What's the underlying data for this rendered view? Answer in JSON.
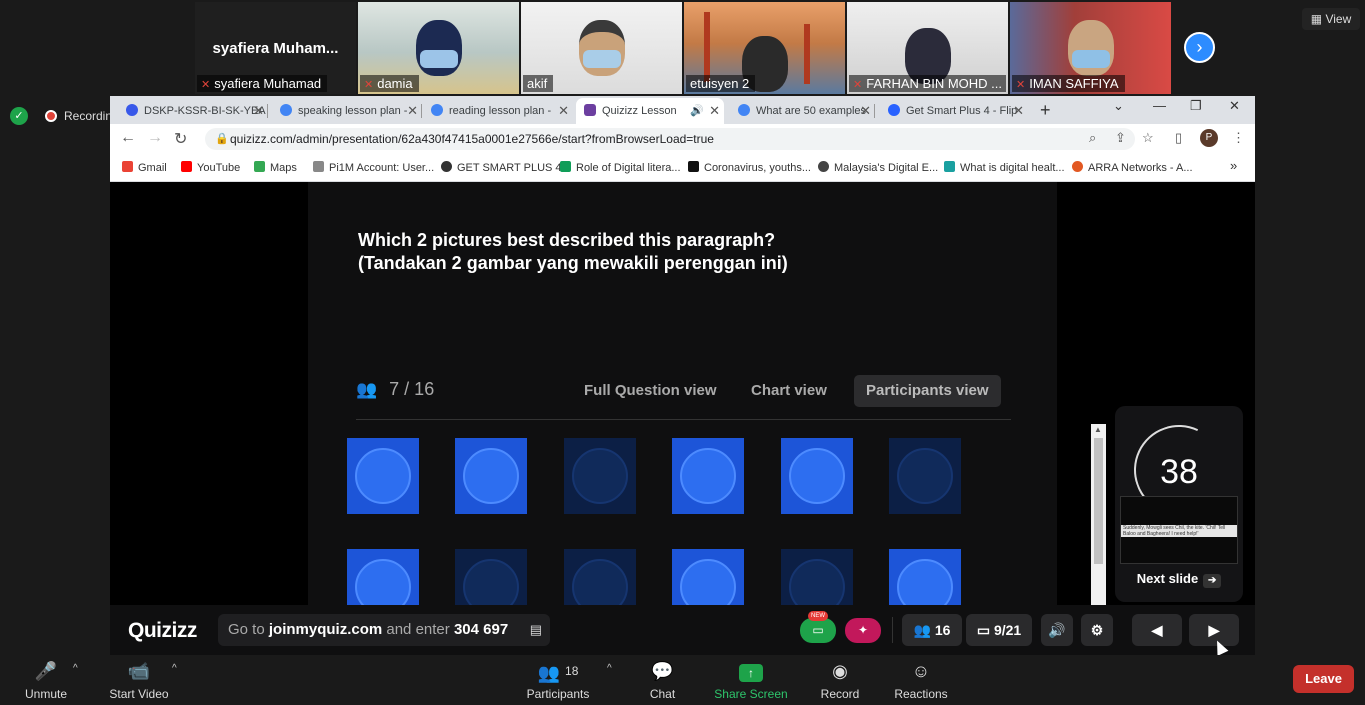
{
  "gallery": {
    "tiles": [
      {
        "name": "syafiera Muhamad",
        "big_name": "syafiera  Muham...",
        "bg": "#1f1f1f"
      },
      {
        "name": "damia",
        "bg": "#b8c7c4",
        "face": "#1c2a52"
      },
      {
        "name": "akif",
        "bg": "#e9e9e9",
        "face": "#3a3a3a"
      },
      {
        "name": "etuisyen 2",
        "bg": "#c37a46",
        "face": "#2a2a2a"
      },
      {
        "name": "FARHAN BIN MOHD ...",
        "bg": "#d9d9d9",
        "face": "#4a4d66"
      },
      {
        "name": "IMAN SAFFIYA",
        "bg": "#a13f3a",
        "face": "#c9a581"
      }
    ],
    "next_icon": "chevron-right-icon",
    "view_label": "View"
  },
  "recording": {
    "label": "Recording"
  },
  "browser": {
    "tabs": [
      {
        "label": "DSKP-KSSR-BI-SK-YEA",
        "color": "#3858e9"
      },
      {
        "label": "speaking lesson plan -",
        "color": "#4285f4"
      },
      {
        "label": "reading lesson plan -",
        "color": "#4285f4"
      },
      {
        "label": "Quizizz Lesson",
        "color": "#6c3fa0"
      },
      {
        "label": "What are 50 examples",
        "color": "#4285f4"
      },
      {
        "label": "Get Smart Plus 4 - Flip",
        "color": "#2962ff"
      }
    ],
    "url": "quizizz.com/admin/presentation/62a430f47415a0001e27566e/start?fromBrowserLoad=true",
    "profile_initial": "P",
    "bookmarks": [
      {
        "label": "Gmail",
        "color": "#ea4335"
      },
      {
        "label": "YouTube",
        "color": "#ff0000"
      },
      {
        "label": "Maps",
        "color": "#34a853"
      },
      {
        "label": "Pi1M Account: User...",
        "color": "#888888"
      },
      {
        "label": "GET SMART PLUS 4",
        "color": "#333333"
      },
      {
        "label": "Role of Digital litera...",
        "color": "#0f9d58"
      },
      {
        "label": "Coronavirus, youths...",
        "color": "#111111"
      },
      {
        "label": "Malaysia's Digital E...",
        "color": "#444444"
      },
      {
        "label": "What is digital healt...",
        "color": "#1aa0a0"
      },
      {
        "label": "ARRA Networks - A...",
        "color": "#e25822"
      }
    ]
  },
  "quiz": {
    "question_line1": "Which 2 pictures best described this paragraph?",
    "question_line2": "(Tandakan 2 gambar yang mewakili perenggan ini)",
    "answered_count": "7 / 16",
    "view_tabs": [
      "Full Question view",
      "Chart view",
      "Participants view"
    ],
    "avatars_row1": [
      true,
      true,
      false,
      true,
      true,
      false
    ],
    "avatars_row2": [
      true,
      false,
      false,
      true,
      false,
      true
    ],
    "timer": "38",
    "next_slide_label": "Next slide",
    "slide_thumb_text": "Suddenly, Mowgli sees Chil, the kite. 'Chil! Tell Baloo and Bagheera! I need help!'"
  },
  "quizbar": {
    "logo": "Quizizz",
    "join_prefix": "Go to",
    "join_site": "joinmyquiz.com",
    "join_middle": "and enter",
    "join_code": "304 697",
    "new_badge": "NEW",
    "participants": "16",
    "slides": "9/21"
  },
  "toolbar": {
    "unmute": "Unmute",
    "start_video": "Start Video",
    "participants": "Participants",
    "participants_count": "18",
    "chat": "Chat",
    "share_screen": "Share Screen",
    "record": "Record",
    "reactions": "Reactions",
    "leave": "Leave"
  },
  "colors": {
    "zoom_blue": "#2d8cff",
    "share_green": "#1ea34a",
    "leave_red": "#c4302b",
    "avatar_blue": "#1d55d8"
  }
}
